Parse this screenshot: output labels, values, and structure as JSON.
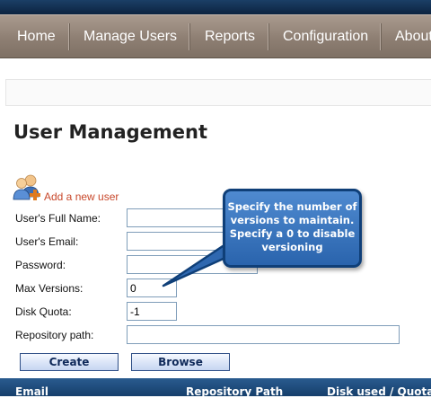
{
  "nav": {
    "items": [
      "Home",
      "Manage Users",
      "Reports",
      "Configuration",
      "About"
    ]
  },
  "page": {
    "title": "User Management"
  },
  "form": {
    "add_link": "Add a new user",
    "full_name": {
      "label": "User's Full Name:",
      "value": ""
    },
    "email": {
      "label": "User's Email:",
      "value": ""
    },
    "password": {
      "label": "Password:",
      "value": ""
    },
    "max_versions": {
      "label": "Max Versions:",
      "value": "0"
    },
    "disk_quota": {
      "label": "Disk Quota:",
      "value": "-1"
    },
    "repo_path": {
      "label": "Repository path:",
      "value": ""
    },
    "create_label": "Create",
    "browse_label": "Browse"
  },
  "callout": {
    "lines": [
      "Specify the number of",
      "versions to maintain.",
      "Specify a 0 to disable",
      "versioning"
    ]
  },
  "table": {
    "headers": [
      "Email",
      "Repository Path",
      "Disk used / Quota"
    ]
  },
  "colors": {
    "nav_background": "#8e7f73",
    "top_strip": "#0c2340",
    "link": "#c8482b",
    "callout_fill": "#3a75bf",
    "table_header": "#1f4d7e"
  }
}
